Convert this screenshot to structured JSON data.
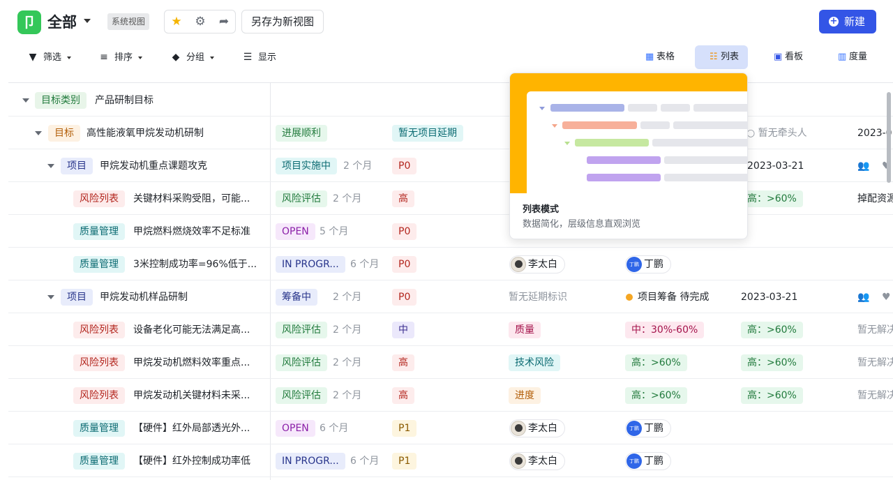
{
  "header": {
    "logo_text": "卩",
    "title": "全部",
    "system_view_badge": "系统视图",
    "save_as": "另存为新视图",
    "new_button": "新建",
    "new_icon": "+"
  },
  "toolbar": {
    "filter": "筛选",
    "sort": "排序",
    "group": "分组",
    "display": "显示"
  },
  "view_tabs": {
    "table": "表格",
    "list": "列表",
    "board": "看板",
    "metric": "度量",
    "active": "列表"
  },
  "popover": {
    "title": "列表模式",
    "desc": "数据简化，层级信息直观浏览"
  },
  "group": {
    "type": "目标类别",
    "name": "产品研制目标"
  },
  "goal": {
    "type": "目标",
    "name": "高性能液氧甲烷发动机研制",
    "status": "进展顺利",
    "delay": "暂无项目延期",
    "owner": "暂无牵头人",
    "date": "2023-0"
  },
  "rows": [
    {
      "type": "项目",
      "name": "甲烷发动机重点课题攻克",
      "status": "项目实施中",
      "dur": "2 个月",
      "pri": "P0",
      "date": "2023-03-21"
    },
    {
      "type": "风险列表",
      "name": "关键材料采购受阻，可能...",
      "status": "风险评估",
      "dur": "2 个月",
      "pri": "高",
      "level": "高：>60%",
      "action": "掉配资源"
    },
    {
      "type": "质量管理",
      "name": "甲烷燃料燃烧效率不足标准",
      "status": "OPEN",
      "dur": "5 个月",
      "pri": "P0"
    },
    {
      "type": "质量管理",
      "name": "3米控制成功率=96%低于...",
      "status": "IN PROGR...",
      "dur": "6 个月",
      "pri": "P0",
      "p1": "李太白",
      "p2": "丁鹏"
    },
    {
      "type": "项目",
      "name": "甲烷发动机样品研制",
      "status": "筹备中",
      "dur": "2 个月",
      "pri": "P0",
      "delay": "暂无延期标识",
      "state": "项目筹备 待完成",
      "date": "2023-03-21"
    },
    {
      "type": "风险列表",
      "name": "设备老化可能无法满足高...",
      "status": "风险评估",
      "dur": "2 个月",
      "pri": "中",
      "cat": "质量",
      "impact": "中：30%-60%",
      "level": "高：>60%",
      "action": "暂无解决"
    },
    {
      "type": "风险列表",
      "name": "甲烷发动机燃料效率重点...",
      "status": "风险评估",
      "dur": "2 个月",
      "pri": "高",
      "cat": "技术风险",
      "impact": "高：>60%",
      "level": "高：>60%",
      "action": "暂无解决"
    },
    {
      "type": "风险列表",
      "name": "甲烷发动机关键材料未采...",
      "status": "风险评估",
      "dur": "2 个月",
      "pri": "高",
      "cat": "进度",
      "impact": "高：>60%",
      "level": "高：>60%",
      "action": "暂无解决"
    },
    {
      "type": "质量管理",
      "name": "【硬件】红外局部透光外...",
      "status": "OPEN",
      "dur": "6 个月",
      "pri": "P1",
      "p1": "李太白",
      "p2": "丁鹏"
    },
    {
      "type": "质量管理",
      "name": "【硬件】红外控制成功率低",
      "status": "IN PROGR...",
      "dur": "6 个月",
      "pri": "P1",
      "p1": "李太白",
      "p2": "丁鹏"
    }
  ],
  "avatar_text": "丁鹏"
}
